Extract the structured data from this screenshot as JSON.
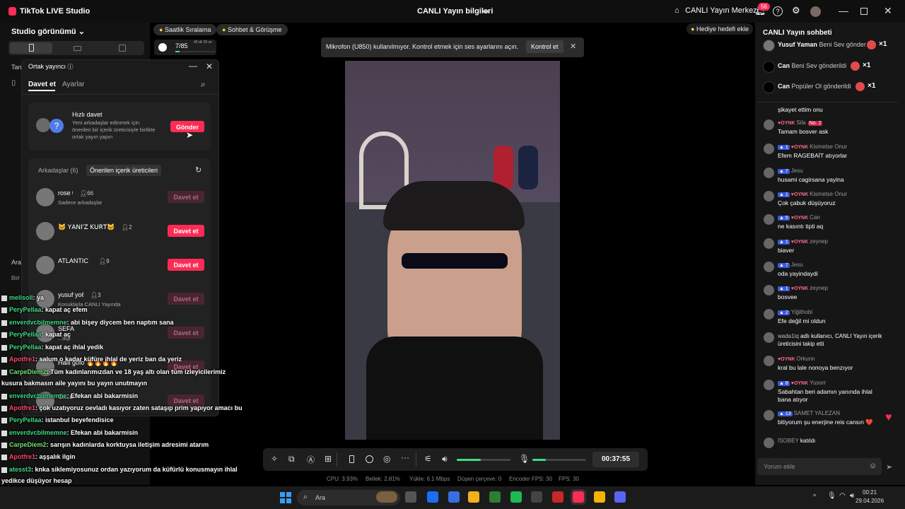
{
  "app": {
    "title": "TikTok LIVE Studio",
    "center_title": "CANLI Yayın bilgileri",
    "live_center": "CANLI Yayın Merkezi",
    "notif_count": "56"
  },
  "left": {
    "studio_view": "Studio görünümü",
    "pill1": "Saatlik Sıralama",
    "pill2": "Sohbet & Görüşme",
    "rank": "7/85",
    "rank_time": "49 dk 39 sn",
    "ghost1": "Tan",
    "ghost2": "Ara",
    "ghost3": "Birl"
  },
  "cohost": {
    "title": "Ortak yayıncı",
    "tab_invite": "Davet et",
    "tab_settings": "Ayarlar",
    "quick_title": "Hızlı davet",
    "quick_desc": "Yeni arkadaşlar edinmek için önerilen bir içerik üreticisiyle birlikte ortak yayın yapın",
    "send": "Gönder",
    "friends_tab": "Arkadaşlar (6)",
    "suggested_tab": "Önerilen içerik üreticileri",
    "rows": [
      {
        "name": "rose ᵎ",
        "count": "66",
        "sub": "Sadece arkadaşlar",
        "btn": "Davet et",
        "active": false
      },
      {
        "name": "🐱 ꓬꓮꓠꓲ'ꓜ ꓗꓴꓣꓔ🐱",
        "count": "2",
        "sub": "",
        "btn": "Davet et",
        "active": true
      },
      {
        "name": "ATLANTIC",
        "count": "9",
        "sub": "",
        "btn": "Davet et",
        "active": true
      },
      {
        "name": "yusuf yoℓ",
        "count": "3",
        "sub": "Konuklarla CANLI Yayında",
        "btn": "Davet et",
        "active": false
      },
      {
        "name": "SEFA",
        "count": "",
        "sub": "...dişi",
        "btn": "Davet et",
        "active": false
      },
      {
        "name": "Halil göfo 🔥🔥🔥🔥",
        "count": "",
        "sub": "",
        "btn": "Davet et",
        "active": false
      },
      {
        "name": "Gi...c",
        "count": "",
        "sub": "",
        "btn": "Davet et",
        "active": false
      }
    ]
  },
  "hint": "Hediye hedefi ekle",
  "toast": {
    "text": "Mikrofon (U850) kullanılmıyor. Kontrol etmek için ses ayarlarını açın.",
    "btn": "Kontrol et"
  },
  "controls": {
    "timer": "00:37:55",
    "volume_level": 0.45,
    "mic_level": 0.25
  },
  "status": {
    "cpu": "CPU: 3.93%",
    "mem": "Bellek: 2.81%",
    "upload": "Yükle: 6.1 Mbps",
    "dropped": "Düşen çerçeve: 0",
    "encfps": "Encoder FPS: 30",
    "fps": "FPS: 30"
  },
  "chat": {
    "title": "CANLI Yayın sohbeti",
    "gifts": [
      {
        "user": "Yusuf Yaman",
        "text": "Beni Sev gönder",
        "x": "×1"
      },
      {
        "user": "Can",
        "text": "Beni Sev gönderildi",
        "x": "×1"
      },
      {
        "user": "Can",
        "text": "Popüler Ol gönderildi",
        "x": "×1"
      }
    ],
    "messages": [
      {
        "user": "",
        "lvl": "",
        "oynk": false,
        "text": "şikayet ettim onu"
      },
      {
        "user": "Sila",
        "lvl": "",
        "oynk": true,
        "text": "Tamam bosver ask",
        "extra": "No. 2"
      },
      {
        "user": "Kismetse Onur",
        "lvl": "1",
        "oynk": true,
        "text": "Efem RAGEBAİT atıyorlar"
      },
      {
        "user": "Jesu",
        "lvl": "7",
        "oynk": false,
        "text": "husami cagirsana yayina"
      },
      {
        "user": "Kismetse Onur",
        "lvl": "1",
        "oynk": true,
        "text": "Çok çabuk düşüyoruz"
      },
      {
        "user": "Can",
        "lvl": "5",
        "oynk": true,
        "text": "ne kasıntı tipti aq"
      },
      {
        "user": "zeynep",
        "lvl": "1",
        "oynk": true,
        "text": "biaver"
      },
      {
        "user": "Jesu",
        "lvl": "7",
        "oynk": false,
        "text": "oda yayindaydi"
      },
      {
        "user": "zeynep",
        "lvl": "1",
        "oynk": true,
        "text": "bosvee"
      },
      {
        "user": "Yiğithobi",
        "lvl": "2",
        "oynk": false,
        "text": "Efe değil mi oldun"
      },
      {
        "user": "wada1iq",
        "lvl": "",
        "oynk": false,
        "text": "adlı kullanıcı, CANLI Yayın içerik üreticisini takip etti"
      },
      {
        "user": "Orkunn",
        "lvl": "",
        "oynk": true,
        "text": "kral bu lale nonoya benzıyor"
      },
      {
        "user": "Yusorr",
        "lvl": "8",
        "oynk": true,
        "text": "Sabahtan beri adamın yanında ihlal bana atıyor"
      },
      {
        "user": "SAMET YALEZAN",
        "lvl": "13",
        "oynk": false,
        "text": "bitiyorum şu enerjine reis cansın ❤️"
      },
      {
        "user": "İSOBEY",
        "lvl": "",
        "oynk": false,
        "text": "katıldı"
      }
    ],
    "input_placeholder": "Yorum ekle"
  },
  "overlay": [
    {
      "u": "melisoll",
      "t": ": ya"
    },
    {
      "u": "PeryPellaa",
      "t": ": kapat aç efem"
    },
    {
      "u": "enverdvcbilmemne",
      "t": ": abi bişey diycem ben naptım sana"
    },
    {
      "u": "PeryPellaa",
      "t": ": kapat aç"
    },
    {
      "u": "PeryPellaa",
      "t": ": kapat aç ihlal yedik"
    },
    {
      "u": "Apotfre1",
      "t": ": salum o kadar küfüre ihlal de yeriz ban da yeriz"
    },
    {
      "u": "CarpeDiem2",
      "t": ": Tüm kadınlarımızdan ve 18 yaş altı olan tüm izleyicilerimiz"
    },
    {
      "u": "",
      "t": "kusura bakmasın aile yayını bu yayın unutmayın"
    },
    {
      "u": "enverdvcbilmemne",
      "t": ": Efekan abi bakarmisin"
    },
    {
      "u": "Apotfre1",
      "t": ": çok uzatıyoruz oevladı kasıyor zaten sataşıp prim yapıyor amacı bu"
    },
    {
      "u": "PeryPellaa",
      "t": ": istanbul beyefendisice"
    },
    {
      "u": "enverdvcbilmemne",
      "t": ": Efekan abi bakarmisin"
    },
    {
      "u": "CarpeDiem2",
      "t": ": sarışın kadınlarda korktuysa iletişim adresimi atarım"
    },
    {
      "u": "Apotfre1",
      "t": ": aşşalık ilgin"
    },
    {
      "u": "atesst3",
      "t": ": knka siklemiyosunuz ordan yazıyorum da küfürlü konusmayın ihlal"
    },
    {
      "u": "",
      "t": "yedikce düşüyor hesap"
    }
  ],
  "taskbar": {
    "search": "Ara",
    "time": "00:21",
    "date": "29.04.2026"
  }
}
